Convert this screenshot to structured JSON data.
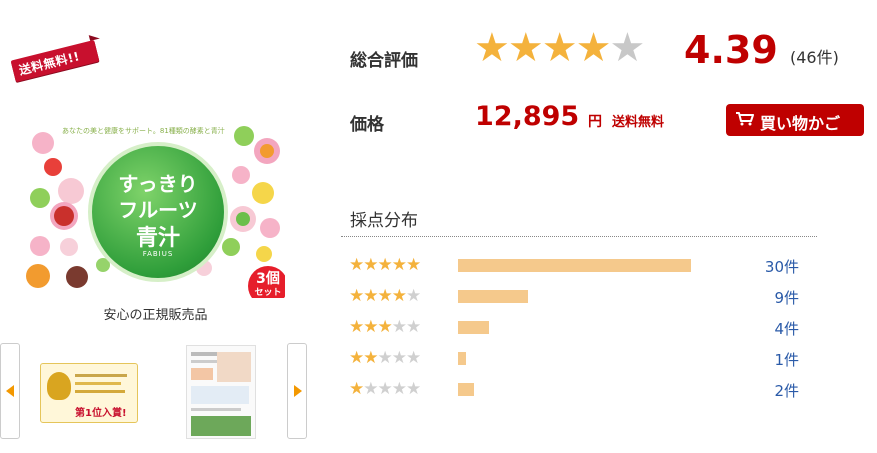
{
  "badge": {
    "text": "送料無料!!"
  },
  "product": {
    "title_lines": [
      "すっきり",
      "フルーツ",
      "青汁"
    ],
    "brand": "FABIUS",
    "set_badge": {
      "number": "3個",
      "unit": "セット"
    },
    "tagline": "あなたの美と健康をサポート。81種類の酵素と青汁",
    "caption": "安心の正規販売品"
  },
  "thumbnails": {
    "award_text": "すっきりフルーツ青汁",
    "award_rank": "第1位入賞!",
    "arrow_left_icon": "caret-left-icon",
    "arrow_right_icon": "caret-right-icon"
  },
  "rating": {
    "label": "総合評価",
    "score": "4.39",
    "value": 4.39,
    "max": 5,
    "count_text": "(46件)"
  },
  "price": {
    "label": "価格",
    "amount": "12,895",
    "currency": "円",
    "shipping": "送料無料"
  },
  "cart_button": {
    "label": "買い物かご",
    "icon": "cart-icon"
  },
  "distribution": {
    "title": "採点分布",
    "rows": [
      {
        "stars": 5,
        "count": 30,
        "count_text": "30件"
      },
      {
        "stars": 4,
        "count": 9,
        "count_text": "9件"
      },
      {
        "stars": 3,
        "count": 4,
        "count_text": "4件"
      },
      {
        "stars": 2,
        "count": 1,
        "count_text": "1件"
      },
      {
        "stars": 1,
        "count": 2,
        "count_text": "2件"
      }
    ]
  },
  "colors": {
    "accent_red": "#bf0000",
    "star_on": "#f4b23c",
    "star_off": "#c8c8c8",
    "bar": "#f5c98c",
    "link_blue": "#2a5aa8",
    "arrow_orange": "#f39800"
  }
}
